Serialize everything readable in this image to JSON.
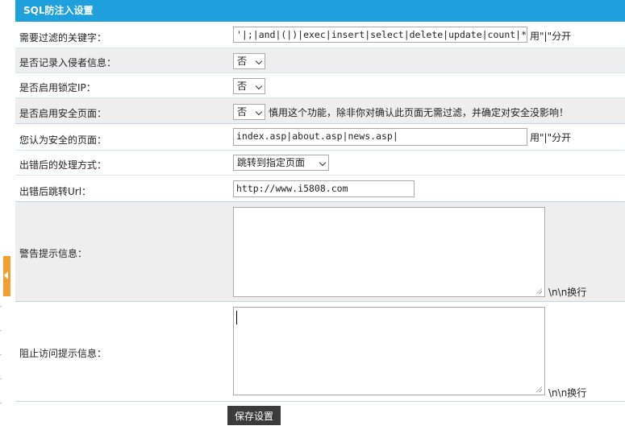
{
  "panel": {
    "title": "SQL防注入设置"
  },
  "form": {
    "keywords": {
      "label": "需要过滤的关键字：",
      "value": "'|;|and|(|)|exec|insert|select|delete|update|count|*|",
      "hint": "用\"|\"分开"
    },
    "log_intruder": {
      "label": "是否记录入侵者信息：",
      "value": "否"
    },
    "lock_ip": {
      "label": "是否启用锁定IP：",
      "value": "否"
    },
    "safe_pages_enabled": {
      "label": "是否启用安全页面：",
      "value": "否",
      "hint": "慎用这个功能，除非你对确认此页面无需过滤，并确定对安全没影响！"
    },
    "safe_pages": {
      "label": "您认为安全的页面：",
      "value": "index.asp|about.asp|news.asp|",
      "hint": "用\"|\"分开"
    },
    "error_action": {
      "label": "出错后的处理方式：",
      "value": "跳转到指定页面"
    },
    "redirect_url": {
      "label": "出错后跳转Url：",
      "value": "http://www.i5808.com"
    },
    "warning_message": {
      "label": "警告提示信息：",
      "value": "",
      "hint": "\\n\\n换行"
    },
    "block_message": {
      "label": "阻止访问提示信息：",
      "value": "",
      "hint": "\\n\\n换行"
    },
    "save_label": "保存设置"
  },
  "colors": {
    "header_bg": "#1ea0dd",
    "side_tab": "#f0a030",
    "button_bg": "#3b3b3b"
  },
  "icons": [
    "collapse-arrow-icon",
    "chevron-down-icon",
    "resize-grip-icon"
  ]
}
